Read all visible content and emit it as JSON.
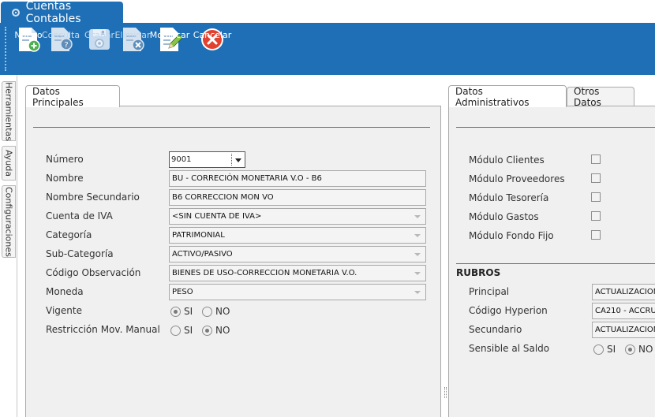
{
  "window": {
    "title": "Cuentas Contables"
  },
  "toolbar": {
    "nuevo": "Nuevo",
    "consulta": "Consulta",
    "grabar": "Grabar",
    "eliminar": "Eliminar",
    "modificar": "Modificar",
    "cancelar": "Cancelar"
  },
  "side_tabs": {
    "herramientas": "Herramientas",
    "ayuda": "Ayuda",
    "configuraciones": "Configuraciones"
  },
  "principal": {
    "tab_label": "Datos Principales",
    "numero": {
      "label": "Número",
      "value": "9001"
    },
    "nombre": {
      "label": "Nombre",
      "value": "BU - CORRECIÓN MONETARIA V.O - B6"
    },
    "nombre_secundario": {
      "label": "Nombre Secundario",
      "value": "B6 CORRECCION MON VO"
    },
    "cuenta_iva": {
      "label": "Cuenta de IVA",
      "value": "<SIN CUENTA DE IVA>"
    },
    "categoria": {
      "label": "Categoría",
      "value": "PATRIMONIAL"
    },
    "sub_categoria": {
      "label": "Sub-Categoría",
      "value": "ACTIVO/PASIVO"
    },
    "codigo_observacion": {
      "label": "Código Observación",
      "value": "BIENES DE USO-CORRECCION MONETARIA V.O."
    },
    "moneda": {
      "label": "Moneda",
      "value": "PESO"
    },
    "vigente": {
      "label": "Vigente",
      "si": "SI",
      "no": "NO",
      "selected": "SI"
    },
    "restriccion": {
      "label": "Restricción Mov. Manual",
      "si": "SI",
      "no": "NO",
      "selected": "NO"
    }
  },
  "administrativos": {
    "tab_label": "Datos Administrativos",
    "other_tab_label": "Otros Datos",
    "modulos": [
      {
        "label": "Módulo Clientes",
        "checked": false
      },
      {
        "label": "Módulo Proveedores",
        "checked": false
      },
      {
        "label": "Módulo Tesorería",
        "checked": false
      },
      {
        "label": "Módulo Gastos",
        "checked": false
      },
      {
        "label": "Módulo Fondo Fijo",
        "checked": false
      }
    ],
    "rubros": {
      "title": "RUBROS",
      "principal": {
        "label": "Principal",
        "value": "ACTUALIZACION"
      },
      "codigo_hyperion": {
        "label": "Código Hyperion",
        "value": "CA210 - ACCRU"
      },
      "secundario": {
        "label": "Secundario",
        "value": "ACTUALIZACION"
      },
      "sensible_saldo": {
        "label": "Sensible al Saldo",
        "si": "SI",
        "no": "NO",
        "selected": "NO"
      }
    }
  },
  "colors": {
    "accent": "#1e6fb5",
    "rule": "#2f7cc4",
    "cancel": "#e2412f"
  }
}
